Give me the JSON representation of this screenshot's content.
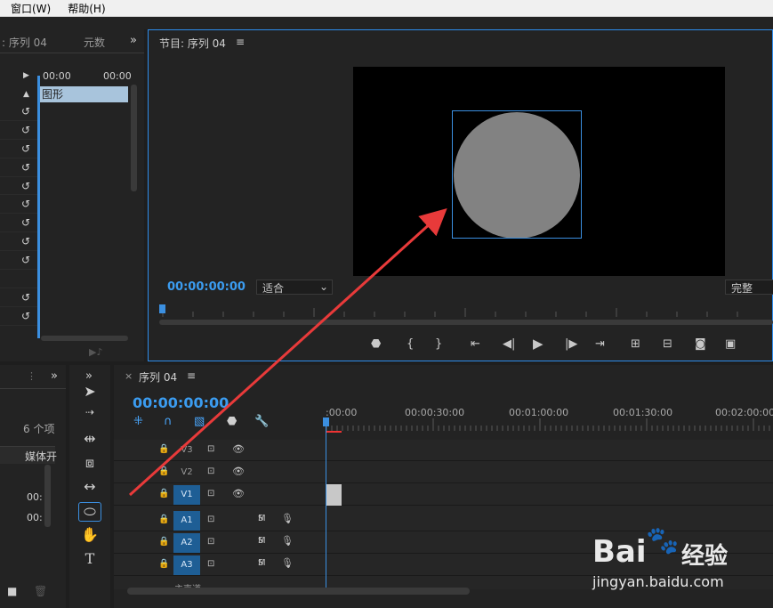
{
  "menu": {
    "window": "窗口(W)",
    "help": "帮助(H)"
  },
  "left_panel": {
    "tab1": ": 序列 04",
    "tab2": "元数",
    "tc_a": "00:00",
    "tc_b": "00:00",
    "clip_label": "图形"
  },
  "program": {
    "title": "节目: 序列 04",
    "timecode": "00:00:00:00",
    "fit_label": "适合",
    "quality_label": "完整"
  },
  "project": {
    "count": "6 个项",
    "col": "媒体开",
    "row1": "00:",
    "row2": "00:"
  },
  "timeline": {
    "tab": "序列 04",
    "timecode": "00:00:00:00",
    "ticks": [
      ":00:00",
      "00:00:30:00",
      "00:01:00:00",
      "00:01:30:00",
      "00:02:00:00"
    ],
    "tracks": [
      {
        "name": "V3",
        "kind": "video",
        "target": false
      },
      {
        "name": "V2",
        "kind": "video",
        "target": false
      },
      {
        "name": "V1",
        "kind": "video",
        "target": true
      },
      {
        "name": "A1",
        "kind": "audio",
        "target": true
      },
      {
        "name": "A2",
        "kind": "audio",
        "target": true
      },
      {
        "name": "A3",
        "kind": "audio",
        "target": true
      }
    ],
    "m_label": "M",
    "s_label": "S",
    "master_label": "主声道"
  },
  "watermark": {
    "logo": "Bai",
    "cn": "经验",
    "url": "jingyan.baidu.com"
  },
  "colors": {
    "accent": "#2d8ceb",
    "timecode": "#3b9cf0",
    "arrow": "#e83a3a",
    "target": "#1e5e95"
  }
}
